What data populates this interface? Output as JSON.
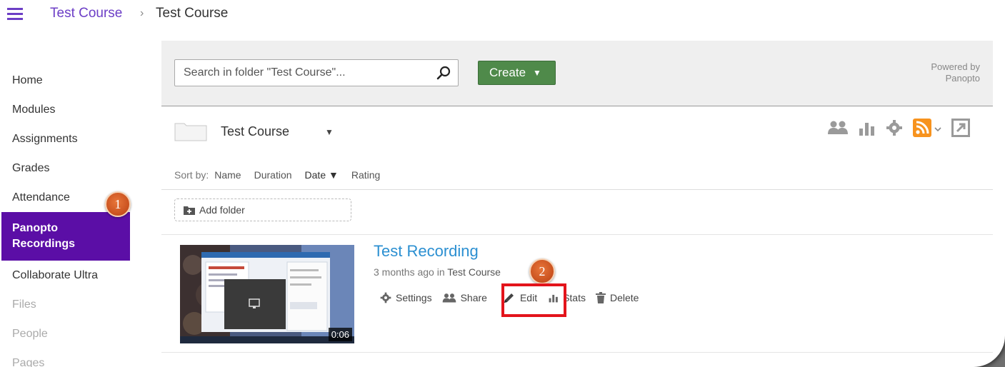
{
  "breadcrumb": {
    "course_link": "Test Course",
    "separator": "›",
    "current": "Test Course"
  },
  "nav": {
    "items": [
      {
        "label": "Home",
        "state": "normal"
      },
      {
        "label": "Modules",
        "state": "normal"
      },
      {
        "label": "Assignments",
        "state": "normal"
      },
      {
        "label": "Grades",
        "state": "normal"
      },
      {
        "label": "Attendance",
        "state": "normal"
      }
    ],
    "active": {
      "line1": "Panopto",
      "line2": "Recordings"
    },
    "items_after": [
      {
        "label": "Collaborate Ultra",
        "state": "normal"
      },
      {
        "label": "Files",
        "state": "disabled"
      },
      {
        "label": "People",
        "state": "disabled"
      },
      {
        "label": "Pages",
        "state": "disabled"
      }
    ]
  },
  "callouts": {
    "one": "1",
    "two": "2"
  },
  "panopto": {
    "search_value": "Search in folder \"Test Course\"...",
    "create_label": "Create",
    "create_caret": "▼",
    "powered_line1": "Powered by",
    "powered_line2": "Panopto",
    "folder_name": "Test Course",
    "folder_caret": "▼",
    "sort": {
      "label": "Sort by:",
      "name": "Name",
      "duration": "Duration",
      "date": "Date ▼",
      "rating": "Rating"
    },
    "add_folder": "Add folder",
    "recording": {
      "title": "Test Recording",
      "meta_prefix": "3 months ago in",
      "meta_folder": "Test Course",
      "duration": "0:06",
      "actions": {
        "settings": "Settings",
        "share": "Share",
        "edit": "Edit",
        "stats": "Stats",
        "delete": "Delete"
      }
    },
    "icons": [
      "users-icon",
      "bar-chart-icon",
      "gear-icon",
      "rss-icon",
      "external-link-icon"
    ]
  },
  "colors": {
    "accent_purple": "#5b0ea6",
    "link_purple": "#6c3ec6",
    "create_green": "#4f8a4a",
    "title_blue": "#2b8fd1",
    "rss_orange": "#f7931e",
    "highlight_red": "#e3141b"
  }
}
